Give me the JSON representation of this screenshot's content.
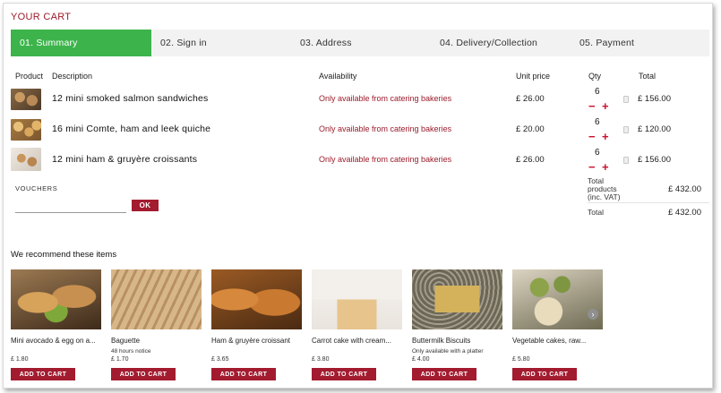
{
  "cart_title": "YOUR CART",
  "steps": [
    {
      "label": "01. Summary"
    },
    {
      "label": "02. Sign in"
    },
    {
      "label": "03. Address"
    },
    {
      "label": "04. Delivery/Collection"
    },
    {
      "label": "05. Payment"
    }
  ],
  "active_step": 0,
  "columns": {
    "product": "Product",
    "description": "Description",
    "availability": "Availability",
    "unit_price": "Unit price",
    "qty": "Qty",
    "total": "Total"
  },
  "items": [
    {
      "description": "12 mini smoked salmon sandwiches",
      "availability": "Only available from catering bakeries",
      "unit_price": "£ 26.00",
      "qty": "6",
      "total": "£ 156.00",
      "minus": "−",
      "plus": "+",
      "image": "salmon-sandwiches-thumb"
    },
    {
      "description": "16 mini Comte, ham and leek quiche",
      "availability": "Only available from catering bakeries",
      "unit_price": "£ 20.00",
      "qty": "6",
      "total": "£ 120.00",
      "minus": "−",
      "plus": "+",
      "image": "quiche-thumb"
    },
    {
      "description": "12 mini ham & gruyère croissants",
      "availability": "Only available from catering bakeries",
      "unit_price": "£ 26.00",
      "qty": "6",
      "total": "£ 156.00",
      "minus": "−",
      "plus": "+",
      "image": "croissants-thumb"
    }
  ],
  "vouchers": {
    "label": "VOUCHERS",
    "placeholder": "",
    "value": "",
    "ok_label": "OK"
  },
  "summary": {
    "products_label": "Total products (inc. VAT)",
    "products_value": "£ 432.00",
    "total_label": "Total",
    "total_value": "£ 432.00"
  },
  "recommend": {
    "title": "We recommend these items",
    "add_label": "ADD TO CART",
    "next_icon": "chevron-right-icon",
    "items": [
      {
        "name": "Mini avocado & egg on a...",
        "note": "",
        "price": "£ 1.80"
      },
      {
        "name": "Baguette",
        "note": "48 hours notice",
        "price": "£ 1.70"
      },
      {
        "name": "Ham & gruyère croissant",
        "note": "",
        "price": "£ 3.65"
      },
      {
        "name": "Carrot cake with cream...",
        "note": "",
        "price": "£ 3.80"
      },
      {
        "name": "Buttermilk Biscuits",
        "note": "Only available with a platter",
        "price": "£ 4.00"
      },
      {
        "name": "Vegetable cakes, raw...",
        "note": "",
        "price": "£ 5.80"
      }
    ]
  },
  "colors": {
    "brand_red": "#a31b2f",
    "active_step_green": "#3cb44b",
    "availability_red": "#9b1b2a"
  }
}
